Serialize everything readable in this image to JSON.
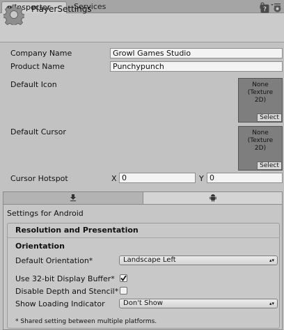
{
  "tabs": {
    "inspector": "Inspector",
    "services": "Services"
  },
  "header": {
    "title": "PlayerSettings",
    "icons": [
      "help-icon",
      "settings-icon"
    ]
  },
  "fields": {
    "company_name_label": "Company Name",
    "company_name_value": "Growl Games Studio",
    "product_name_label": "Product Name",
    "product_name_value": "Punchypunch",
    "default_icon_label": "Default Icon",
    "default_cursor_label": "Default Cursor",
    "texture_none": "None\n(Texture\n2D)",
    "select_label": "Select",
    "cursor_hotspot_label": "Cursor Hotspot",
    "x_label": "X",
    "x_value": "0",
    "y_label": "Y",
    "y_value": "0"
  },
  "platform_tabs": [
    "download-icon",
    "android-icon"
  ],
  "android": {
    "settings_for": "Settings for Android",
    "section_title": "Resolution and Presentation",
    "orientation_title": "Orientation",
    "default_orientation_label": "Default Orientation*",
    "default_orientation_value": "Landscape Left",
    "use_32bit_label": "Use 32-bit Display Buffer*",
    "use_32bit_checked": true,
    "disable_depth_label": "Disable Depth and Stencil*",
    "disable_depth_checked": false,
    "loading_indicator_label": "Show Loading Indicator",
    "loading_indicator_value": "Don't Show",
    "footnote": "* Shared setting between multiple platforms."
  }
}
